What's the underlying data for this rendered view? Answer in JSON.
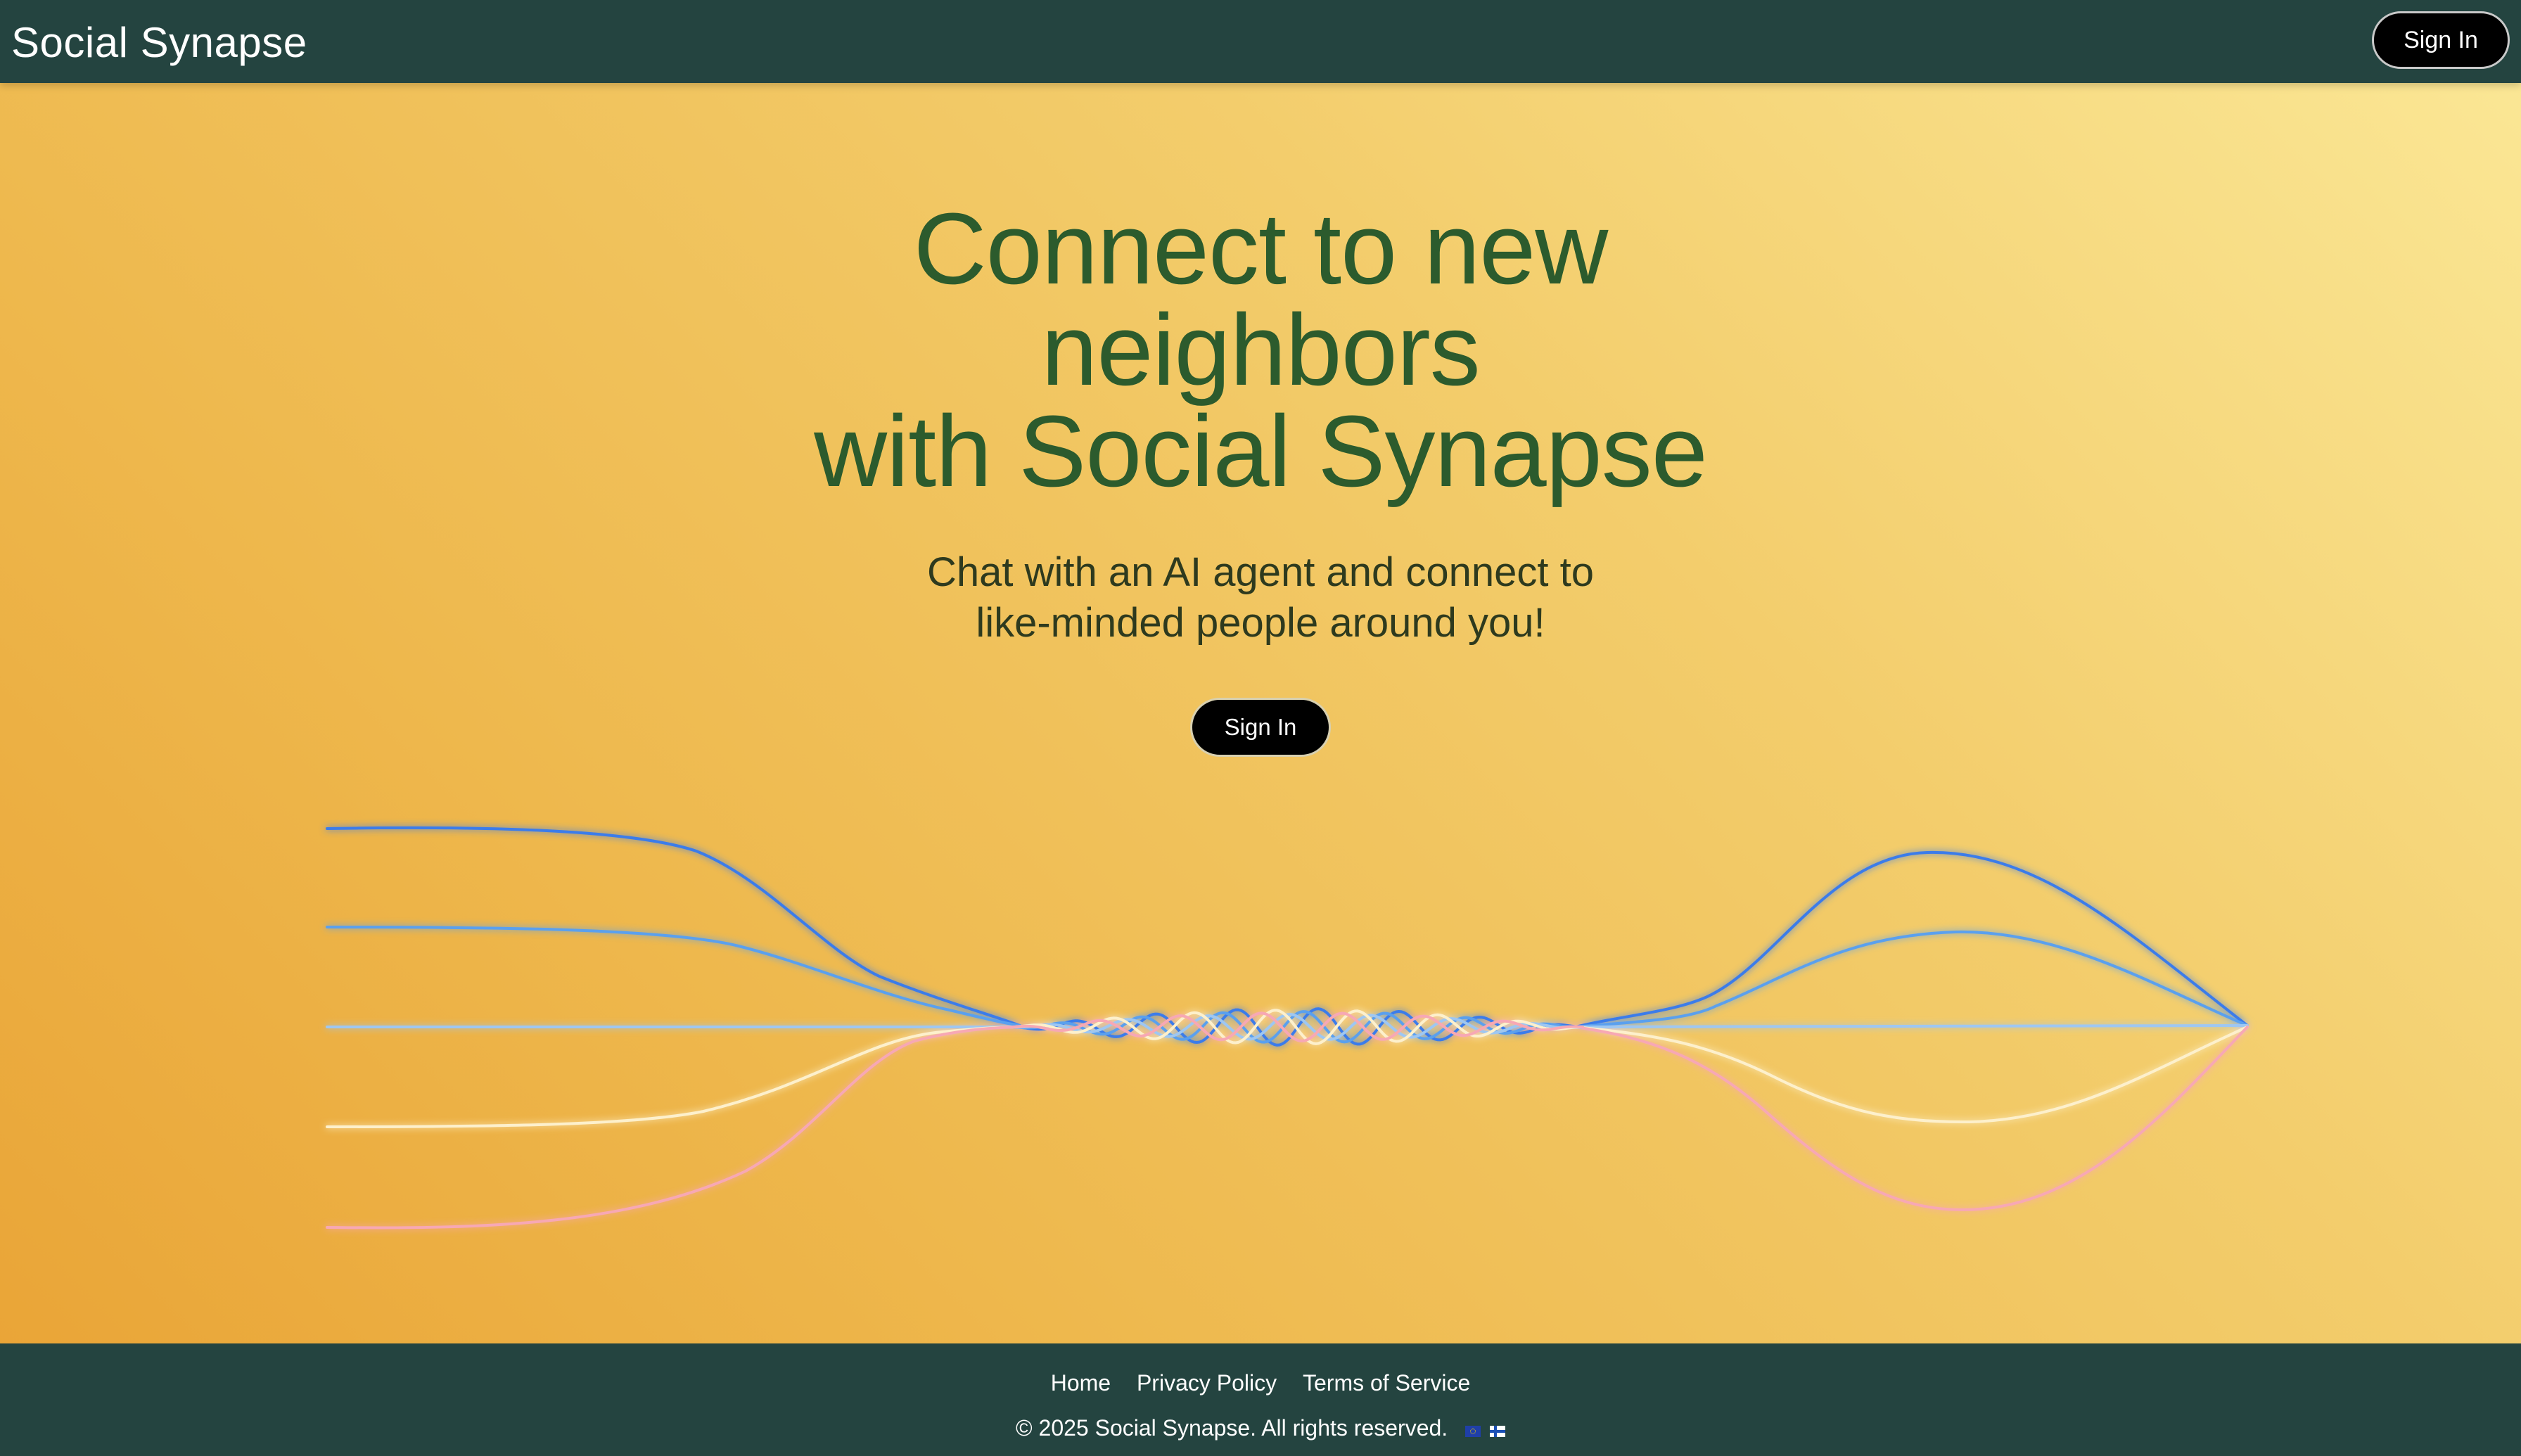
{
  "header": {
    "brand": "Social Synapse",
    "signin_label": "Sign In"
  },
  "hero": {
    "title_lines": [
      "Connect to new",
      "neighbors",
      "with Social Synapse"
    ],
    "subtitle_lines": [
      "Chat with an AI agent and connect to",
      "like-minded people around you!"
    ],
    "signin_label": "Sign In"
  },
  "footer": {
    "links": [
      "Home",
      "Privacy Policy",
      "Terms of Service"
    ],
    "copyright": "© 2025 Social Synapse. All rights reserved.",
    "flag_icons": [
      "eu-flag-icon",
      "finland-flag-icon"
    ]
  },
  "colors": {
    "header_bg": "#244440",
    "footer_bg": "#244440",
    "title": "#2c5b2d",
    "gradient_light": "#fbe897",
    "gradient_dark": "#e9a335",
    "button_bg": "#000000",
    "wave_blue_dark": "#3a7bea",
    "wave_blue": "#5aa0ee",
    "wave_light_blue": "#9ec7f2",
    "wave_cream": "#fdf0cc",
    "wave_pink": "#f7a8b4"
  }
}
